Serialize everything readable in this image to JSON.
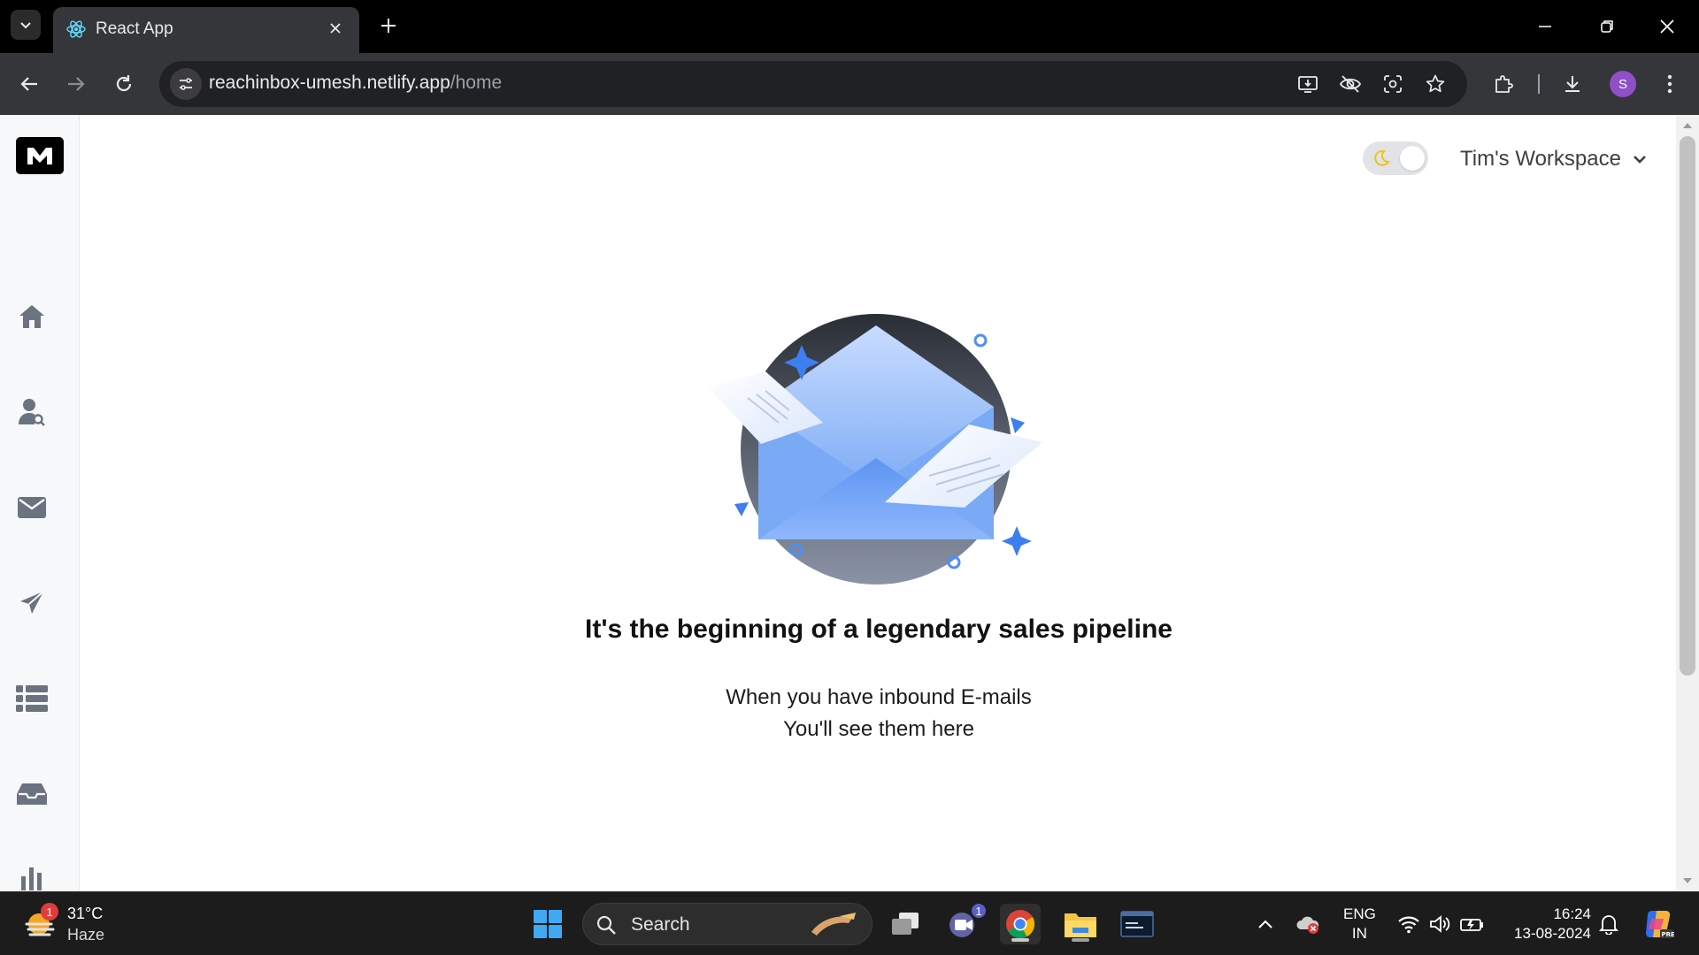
{
  "browser": {
    "tab_title": "React App",
    "url_host": "reachinbox-umesh.netlify.app",
    "url_path": "/home",
    "profile_initial": "S"
  },
  "app": {
    "theme_mode": "light",
    "workspace_label": "Tim's Workspace",
    "sidebar": {
      "items": [
        {
          "icon": "home-icon"
        },
        {
          "icon": "user-search-icon"
        },
        {
          "icon": "mail-icon"
        },
        {
          "icon": "send-icon"
        },
        {
          "icon": "list-icon"
        },
        {
          "icon": "inbox-icon"
        },
        {
          "icon": "chart-icon"
        }
      ]
    },
    "empty_state": {
      "title": "It's the beginning of a legendary sales pipeline",
      "line1": "When you have inbound E-mails",
      "line2": "You'll see them here"
    }
  },
  "taskbar": {
    "weather_temp": "31°C",
    "weather_condition": "Haze",
    "weather_badge": "1",
    "search_label": "Search",
    "teams_badge": "1",
    "language_line1": "ENG",
    "language_line2": "IN",
    "time": "16:24",
    "date": "13-08-2024"
  },
  "colors": {
    "accent_blue": "#4f8ef7",
    "profile_purple": "#8e4fc9"
  }
}
